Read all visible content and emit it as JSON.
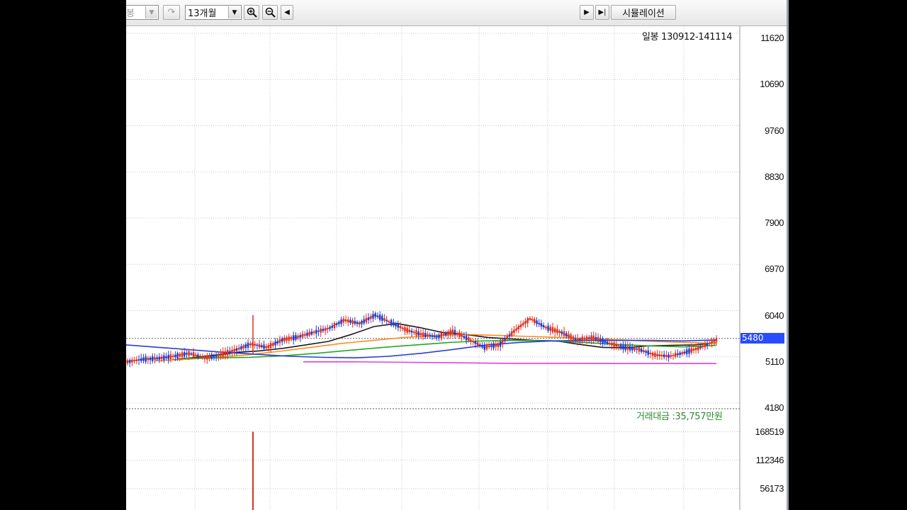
{
  "toolbar": {
    "left_combo": "봉",
    "period_combo": "13개월",
    "simulation_label": "시뮬레이션",
    "icons": [
      "dropdown-arrow-icon",
      "redo-icon",
      "zoom-in-icon",
      "zoom-out-icon",
      "scroll-left-icon",
      "play-icon",
      "step-end-icon"
    ]
  },
  "chart": {
    "period_label": "일봉  130912-141114",
    "current_price": "5480",
    "volume_label": "거래대금 :35,757만원",
    "price_axis": [
      "11620",
      "10690",
      "9760",
      "8830",
      "7900",
      "6970",
      "6040",
      "5110",
      "4180"
    ],
    "volume_axis": [
      "168519",
      "112346",
      "56173"
    ]
  },
  "chart_data": {
    "type": "line",
    "title": "",
    "x_range": [
      "130912",
      "141114"
    ],
    "price_ylim": [
      4180,
      11620
    ],
    "series": [
      {
        "values": [
          5010,
          5060,
          5080,
          5120,
          5180,
          5090,
          5150,
          5250,
          5370,
          5300,
          5450,
          5510,
          5600,
          5680,
          5850,
          5780,
          5950,
          5800,
          5650,
          5560,
          5510,
          5620,
          5470,
          5300,
          5350,
          5640,
          5880,
          5700,
          5600,
          5450,
          5500,
          5390,
          5300,
          5260,
          5150,
          5120,
          5200,
          5300,
          5450
        ],
        "color": "#e0502d"
      },
      {
        "values": [
          5040,
          5090,
          5140,
          5200,
          5230,
          5280,
          5350,
          5420,
          5560,
          5720,
          5780,
          5700,
          5600,
          5560,
          5500,
          5470,
          5440,
          5430,
          5360,
          5300,
          5290,
          5330,
          5340,
          5350,
          5390
        ],
        "color": "#1a1a1a"
      },
      {
        "values": [
          5030,
          5060,
          5100,
          5150,
          5220,
          5300,
          5380,
          5440,
          5500,
          5540,
          5560,
          5540,
          5520,
          5500,
          5470,
          5450,
          5420,
          5400,
          5380
        ],
        "color": "#ff8c1a"
      },
      {
        "values": [
          5080,
          5090,
          5100,
          5130,
          5180,
          5240,
          5300,
          5350,
          5400,
          5430,
          5440,
          5430,
          5400,
          5360,
          5330,
          5310,
          5340
        ],
        "color": "#22aa22"
      },
      {
        "values": [
          5350,
          5300,
          5250,
          5200,
          5160,
          5120,
          5100,
          5090,
          5120,
          5180,
          5260,
          5350,
          5400,
          5430,
          5440,
          5440,
          5440,
          5430,
          5450
        ],
        "color": "#2d3cd6"
      },
      {
        "values": [
          5010,
          5010,
          5000,
          4990,
          4980,
          4980,
          4975,
          4975,
          4975
        ],
        "color": "#e040e0"
      }
    ],
    "volume_ylim": [
      0,
      200000
    ],
    "volume_spike": 168519
  },
  "colors": {
    "up": "#e0301e",
    "down": "#1f3bd6",
    "grid": "#c8c8c8",
    "price_tag": "#2a4bff"
  }
}
